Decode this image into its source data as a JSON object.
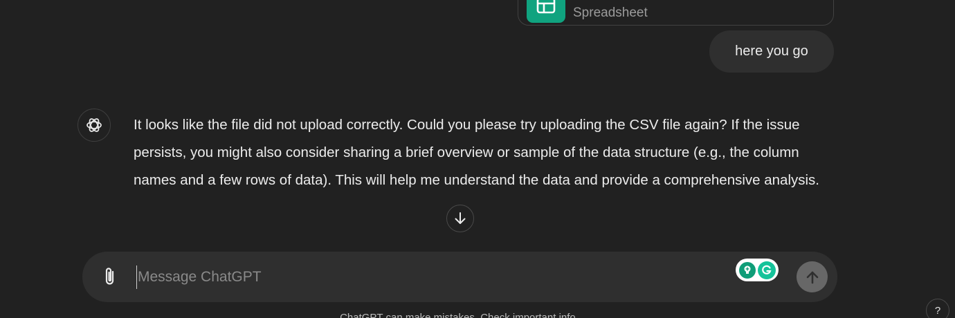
{
  "attachment": {
    "file_type": "Spreadsheet",
    "icon": "spreadsheet-icon",
    "accent_color": "#10a37f"
  },
  "user_message": {
    "text": "here you go"
  },
  "assistant_message": {
    "avatar_icon": "openai-logo-icon",
    "text": "It looks like the file did not upload correctly. Could you please try uploading the CSV file again? If the issue persists, you might also consider sharing a brief overview or sample of the data structure (e.g., the column names and a few rows of data). This will help me understand the data and provide a comprehensive analysis."
  },
  "scroll_down": {
    "icon": "arrow-down-icon"
  },
  "composer": {
    "attach_icon": "paperclip-icon",
    "placeholder": "Message ChatGPT",
    "value": "",
    "send_icon": "arrow-up-icon",
    "grammarly_icons": [
      "grammarly-suggestion-icon",
      "grammarly-logo-icon"
    ]
  },
  "footer": {
    "note": "ChatGPT can make mistakes. Check important info.",
    "help_label": "?"
  }
}
